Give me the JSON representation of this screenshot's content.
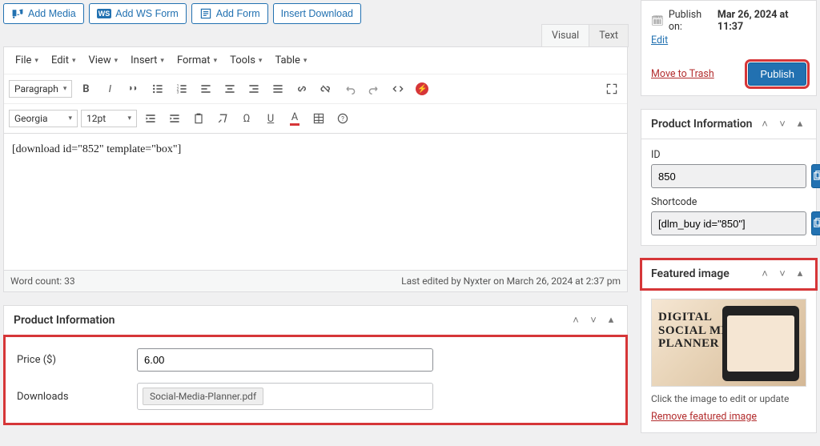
{
  "mediaBar": {
    "addMedia": "Add Media",
    "addWsForm": "Add WS Form",
    "wsBadge": "WS",
    "addForm": "Add Form",
    "insertDownload": "Insert Download"
  },
  "editorTabs": {
    "visual": "Visual",
    "text": "Text"
  },
  "menus": [
    "File",
    "Edit",
    "View",
    "Insert",
    "Format",
    "Tools",
    "Table"
  ],
  "formatSelect": "Paragraph",
  "fontSelect": "Georgia",
  "sizeSelect": "12pt",
  "editorContent": "[download id=\"852\" template=\"box\"]",
  "wordCount": "Word count: 33",
  "lastEdited": "Last edited by Nyxter on March 26, 2024 at 2:37 pm",
  "productInfo": {
    "title": "Product Information",
    "priceLabel": "Price ($)",
    "priceValue": "6.00",
    "downloadsLabel": "Downloads",
    "fileName": "Social-Media-Planner.pdf"
  },
  "publish": {
    "scheduleLabel": "Publish on:",
    "scheduleValue": "Mar 26, 2024 at 11:37",
    "edit": "Edit",
    "trash": "Move to Trash",
    "button": "Publish"
  },
  "sideProduct": {
    "idLabel": "ID",
    "idValue": "850",
    "shortcodeLabel": "Shortcode",
    "shortcodeValue": "[dlm_buy id=\"850\"]"
  },
  "featured": {
    "title": "Featured image",
    "overlay": "Digital\nSocial Media\nPlanner",
    "caption": "Click the image to edit or update",
    "remove": "Remove featured image"
  }
}
